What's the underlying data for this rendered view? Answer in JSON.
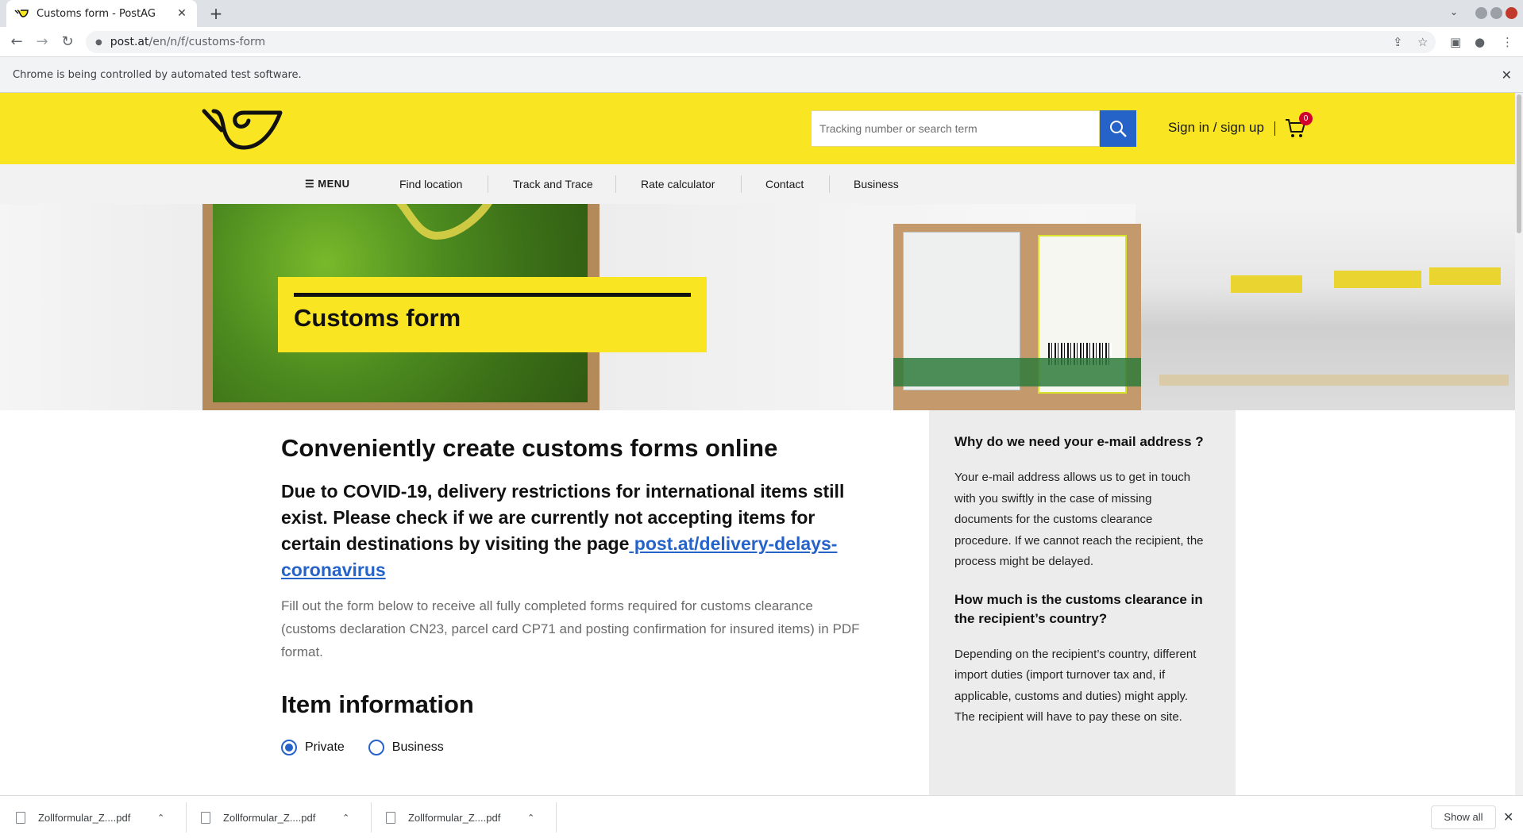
{
  "browser": {
    "tab_title": "Customs form - PostAG",
    "tab_close": "✕",
    "new_tab": "+",
    "tab_menu": "⌄",
    "url_host": "post.at",
    "url_path": "/en/n/f/customs-form",
    "infobar_text": "Chrome is being controlled by automated test software.",
    "infobar_close": "✕"
  },
  "header": {
    "search_placeholder": "Tracking number or search term",
    "signin_label": "Sign in / sign up",
    "cart_count": "0",
    "brand_color": "#f9e521",
    "accent_color": "#2563c9"
  },
  "nav": {
    "menu_label": "MENU",
    "items": [
      "Find location",
      "Track and Trace",
      "Rate calculator",
      "Contact",
      "Business"
    ]
  },
  "hero": {
    "title": "Customs form"
  },
  "main": {
    "heading": "Conveniently create customs forms online",
    "covid_text": "Due to COVID-19, delivery restrictions for international items still exist. Please check if we are currently not accepting items for certain destinations by visiting the page",
    "covid_link": " post.at/delivery-delays-coronavirus",
    "intro": "Fill out the form below to receive all fully completed forms required for customs clearance (customs declaration CN23, parcel card CP71 and posting confirmation for insured items) in PDF format.",
    "item_heading": "Item information",
    "radio_private": "Private",
    "radio_business": "Business",
    "selected": "Private"
  },
  "sidebar": {
    "q1": "Why do we need your e-mail address ?",
    "a1": "Your e-mail address allows us to get in touch with you swiftly in the case of missing documents for the customs clearance procedure. If we cannot reach the recipient, the process might be delayed.",
    "q2": "How much is the customs clearance in the recipient’s country?",
    "a2": "Depending on the recipient’s country, different import duties (import turnover tax and, if applicable, customs and duties) might apply. The recipient will have to pay these on site."
  },
  "downloads": {
    "items": [
      "Zollformular_Z....pdf",
      "Zollformular_Z....pdf",
      "Zollformular_Z....pdf"
    ],
    "chevron": "⌃",
    "show_all": "Show all",
    "close": "✕"
  }
}
